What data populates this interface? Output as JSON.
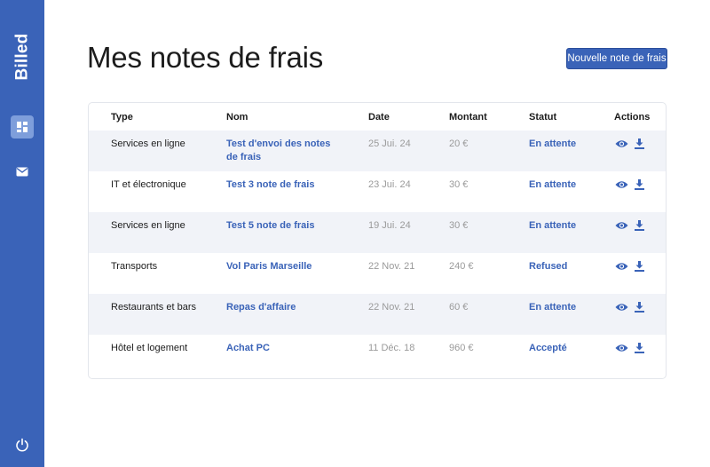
{
  "sidebar": {
    "brand": "Billed",
    "items": [
      {
        "name": "bills",
        "icon": "window-icon",
        "active": true
      },
      {
        "name": "mail",
        "icon": "mail-icon",
        "active": false
      }
    ],
    "logout_icon": "power-icon"
  },
  "header": {
    "title": "Mes notes de frais",
    "new_button_label": "Nouvelle note de frais"
  },
  "table": {
    "columns": [
      "Type",
      "Nom",
      "Date",
      "Montant",
      "Statut",
      "Actions"
    ],
    "rows": [
      {
        "type": "Services en ligne",
        "name": "Test d'envoi des notes de frais",
        "date": "25 Jui. 24",
        "amount": "20 €",
        "status": "En attente"
      },
      {
        "type": "IT et électronique",
        "name": "Test 3 note de frais",
        "date": "23 Jui. 24",
        "amount": "30 €",
        "status": "En attente"
      },
      {
        "type": "Services en ligne",
        "name": "Test 5 note de frais",
        "date": "19 Jui. 24",
        "amount": "30 €",
        "status": "En attente"
      },
      {
        "type": "Transports",
        "name": "Vol Paris Marseille",
        "date": "22 Nov. 21",
        "amount": "240 €",
        "status": "Refused"
      },
      {
        "type": "Restaurants et bars",
        "name": "Repas d'affaire",
        "date": "22 Nov. 21",
        "amount": "60 €",
        "status": "En attente"
      },
      {
        "type": "Hôtel et logement",
        "name": "Achat PC",
        "date": "11 Déc. 18",
        "amount": "960 €",
        "status": "Accepté"
      }
    ],
    "action_icons": [
      "eye-icon",
      "download-icon"
    ]
  },
  "colors": {
    "accent": "#3a63b8",
    "active_nav_bg": "#7e9edb",
    "row_stripe": "#f1f3f8",
    "muted_text": "#9a9a9a"
  }
}
